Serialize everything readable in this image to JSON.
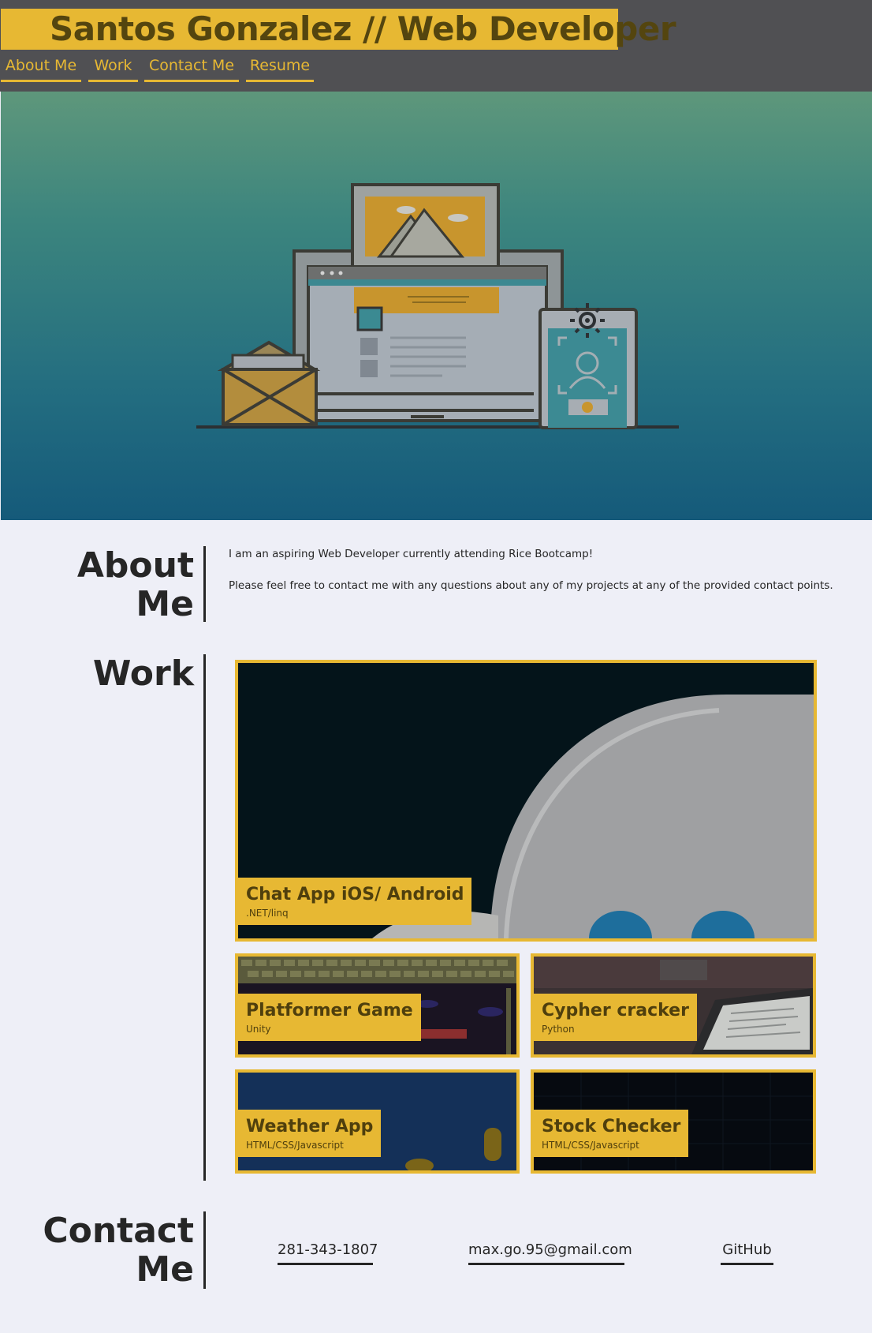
{
  "header": {
    "title": "Santos Gonzalez // Web Developer",
    "nav": [
      "About Me",
      "Work",
      "Contact Me",
      "Resume"
    ]
  },
  "hero": {
    "illustration": "devices-illustration"
  },
  "about": {
    "heading_line1": "About",
    "heading_line2": "Me",
    "paragraph1": "I am an aspiring Web Developer currently attending Rice Bootcamp!",
    "paragraph2": "Please feel free to contact me with any questions about any of my projects at any of the provided contact points."
  },
  "work": {
    "heading": "Work",
    "projects": [
      {
        "title": "Chat App iOS/ Android",
        "subtitle": ".NET/linq"
      },
      {
        "title": "Platformer Game",
        "subtitle": "Unity"
      },
      {
        "title": "Cypher cracker",
        "subtitle": "Python"
      },
      {
        "title": "Weather App",
        "subtitle": "HTML/CSS/Javascript"
      },
      {
        "title": "Stock Checker",
        "subtitle": "HTML/CSS/Javascript"
      }
    ]
  },
  "contact": {
    "heading_line1": "Contact",
    "heading_line2": "Me",
    "phone": "281-343-1807",
    "email": "max.go.95@gmail.com",
    "github": "GitHub"
  },
  "colors": {
    "accent": "#e7b833",
    "header_bg": "#505053",
    "page_bg": "#eeeff7",
    "text": "#262626"
  }
}
